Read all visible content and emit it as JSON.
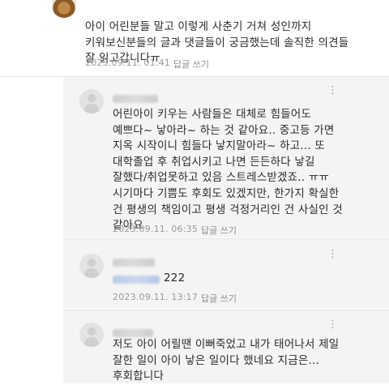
{
  "comments": [
    {
      "text": "아이 어린분들 말고 이렇게 사춘기 거쳐 성인까지\n키워보신분들의 글과 댓글들이 궁금했는데 솔직한 의견들\n잘 읽고갑니다ㅠ",
      "timestamp": "2023.09.11. 01:41",
      "reply_label": "답글 쓰기"
    }
  ],
  "replies": [
    {
      "text": "어린아이 키우는 사람들은 대체로 힘들어도\n예쁘다~ 낳아라~ 하는 것 같아요.. 중고등 가면\n지옥 시작이니 힘들다 낳지말아라~ 하고... 또\n대학졸업 후 취업시키고 나면 든든하다 낳길\n잘했다/취업못하고 있음 스트레스받겠죠.. ㅠㅠ\n시기마다 기쁨도 후회도 있겠지만, 한가지 확실한\n건 평생의 책임이고 평생 걱정거리인 건 사실인 것\n같아요",
      "timestamp": "2023.09.11. 06:35",
      "reply_label": "답글 쓰기"
    },
    {
      "text": "222",
      "timestamp": "2023.09.11. 13:17",
      "reply_label": "답글 쓰기"
    },
    {
      "text": "저도 아이 어릴땐 이뻐죽었고 내가 태어나서 제일\n잘한 일이 아이 낳은 일이다 했네요 지금은...\n후회합니다"
    }
  ],
  "icons": {
    "more": "more-vertical-icon"
  }
}
